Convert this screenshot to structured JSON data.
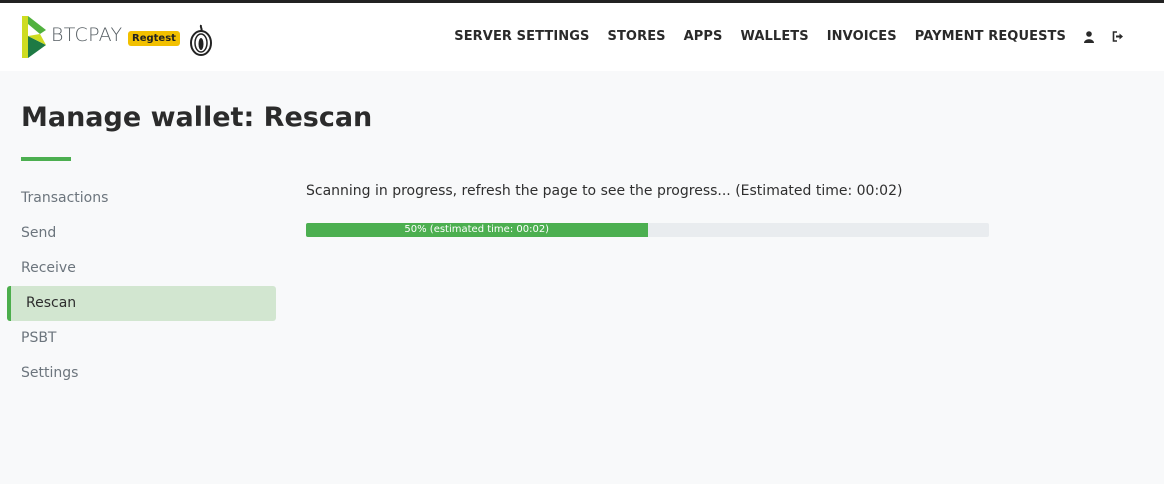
{
  "brand": {
    "name": "BTCPAY",
    "badge": "Regtest",
    "accent_color": "#4caf50",
    "badge_color": "#f2c000"
  },
  "nav": {
    "items": [
      "SERVER SETTINGS",
      "STORES",
      "APPS",
      "WALLETS",
      "INVOICES",
      "PAYMENT REQUESTS"
    ],
    "icons": [
      "user-icon",
      "logout-icon"
    ]
  },
  "page": {
    "title": "Manage wallet: Rescan"
  },
  "sidebar": {
    "items": [
      {
        "label": "Transactions",
        "active": false
      },
      {
        "label": "Send",
        "active": false
      },
      {
        "label": "Receive",
        "active": false
      },
      {
        "label": "Rescan",
        "active": true
      },
      {
        "label": "PSBT",
        "active": false
      },
      {
        "label": "Settings",
        "active": false
      }
    ]
  },
  "main": {
    "status_text": "Scanning in progress, refresh the page to see the progress... (Estimated time: 00:02)",
    "progress": {
      "percent": 50,
      "label": "50% (estimated time: 00:02)"
    }
  }
}
